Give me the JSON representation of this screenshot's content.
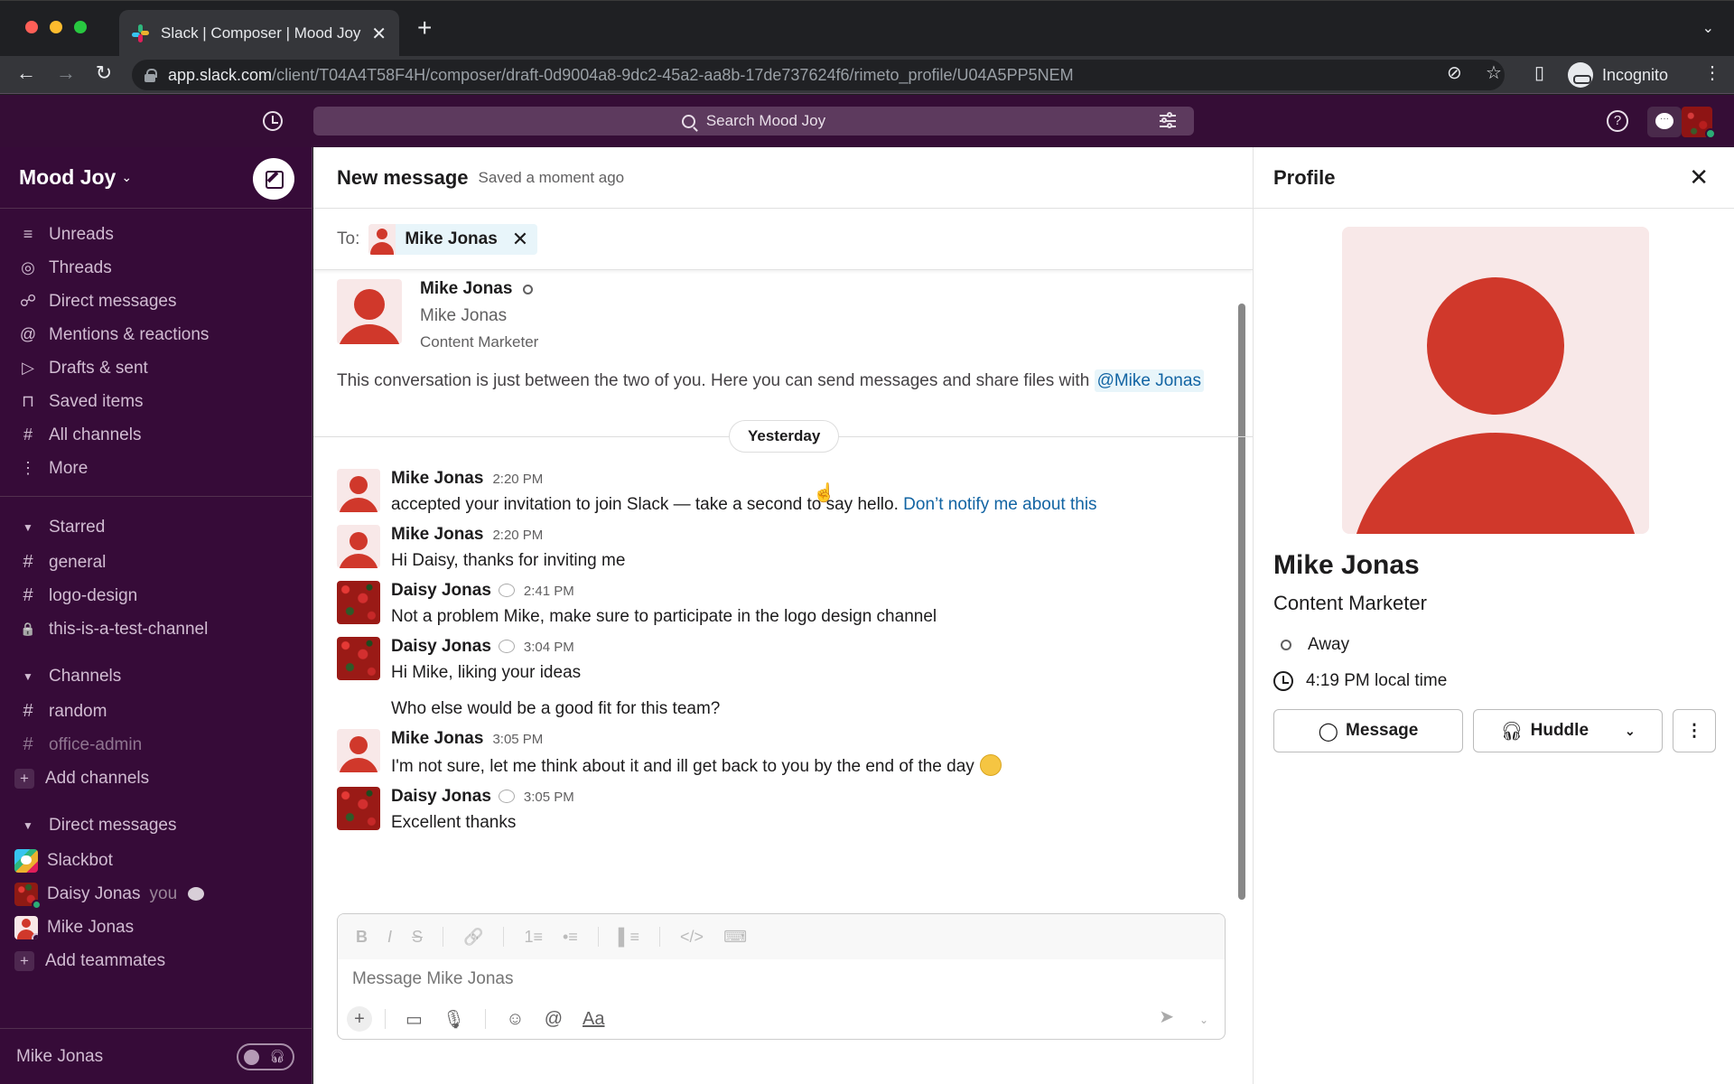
{
  "browser": {
    "tab_title": "Slack | Composer | Mood Joy",
    "tab_close": "✕",
    "new_tab": "+",
    "url_host": "app.slack.com",
    "url_path": "/client/T04A4T58F4H/composer/draft-0d9004a8-9dc2-45a2-aa8b-17de737624f6/rimeto_profile/U04A5PP5NEM",
    "incognito_label": "Incognito"
  },
  "topbar": {
    "search_placeholder": "Search Mood Joy",
    "help": "?"
  },
  "sidebar": {
    "workspace": "Mood Joy",
    "nav": [
      {
        "label": "Unreads",
        "icon": "≡"
      },
      {
        "label": "Threads",
        "icon": "◎"
      },
      {
        "label": "Direct messages",
        "icon": "☍"
      },
      {
        "label": "Mentions & reactions",
        "icon": "@"
      },
      {
        "label": "Drafts & sent",
        "icon": "▷"
      },
      {
        "label": "Saved items",
        "icon": "⊓"
      },
      {
        "label": "All channels",
        "icon": "#"
      },
      {
        "label": "More",
        "icon": "⋮"
      }
    ],
    "starred": {
      "title": "Starred",
      "items": [
        {
          "label": "general",
          "icon": "#"
        },
        {
          "label": "logo-design",
          "icon": "#"
        },
        {
          "label": "this-is-a-test-channel",
          "icon": "🔒"
        }
      ]
    },
    "channels": {
      "title": "Channels",
      "items": [
        {
          "label": "random",
          "icon": "#"
        },
        {
          "label": "office-admin",
          "icon": "#"
        }
      ],
      "add": "Add channels"
    },
    "dms": {
      "title": "Direct messages",
      "items": [
        {
          "label": "Slackbot"
        },
        {
          "label": "Daisy Jonas",
          "suffix": "you"
        },
        {
          "label": "Mike Jonas"
        }
      ],
      "add": "Add teammates"
    },
    "footer_user": "Mike Jonas"
  },
  "main": {
    "title": "New message",
    "saved": "Saved a moment ago",
    "to_label": "To:",
    "recipient": "Mike Jonas",
    "intro": {
      "name": "Mike Jonas",
      "display_name": "Mike Jonas",
      "title": "Content Marketer",
      "text": "This conversation is just between the two of you. Here you can send messages and share files with",
      "mention": "@Mike Jonas"
    },
    "day_divider": "Yesterday",
    "messages": [
      {
        "author": "Mike Jonas",
        "time": "2:20 PM",
        "text": "accepted your invitation to join Slack — take a second to say hello.",
        "link": "Don’t notify me about this"
      },
      {
        "author": "Mike Jonas",
        "time": "2:20 PM",
        "text": "Hi Daisy, thanks for inviting me"
      },
      {
        "author": "Daisy Jonas",
        "time": "2:41 PM",
        "text": "Not a problem Mike, make sure to participate in the logo design channel"
      },
      {
        "author": "Daisy Jonas",
        "time": "3:04 PM",
        "text": "Hi Mike, liking your ideas",
        "text2": "Who else would be a good fit for this team?"
      },
      {
        "author": "Mike Jonas",
        "time": "3:05 PM",
        "text": "I'm not sure, let me think about it and ill get back to you by the end of the day"
      },
      {
        "author": "Daisy Jonas",
        "time": "3:05 PM",
        "text": "Excellent thanks"
      }
    ],
    "composer": {
      "placeholder": "Message Mike Jonas",
      "format_buttons": [
        "B",
        "I",
        "S",
        "🔗",
        "1≡",
        "•≡",
        "▌≡",
        "</>",
        "⌨"
      ],
      "aa": "Aa"
    }
  },
  "profile": {
    "title": "Profile",
    "name": "Mike Jonas",
    "job_title": "Content Marketer",
    "status": "Away",
    "local_time": "4:19 PM local time",
    "message_btn": "Message",
    "huddle_btn": "Huddle"
  }
}
